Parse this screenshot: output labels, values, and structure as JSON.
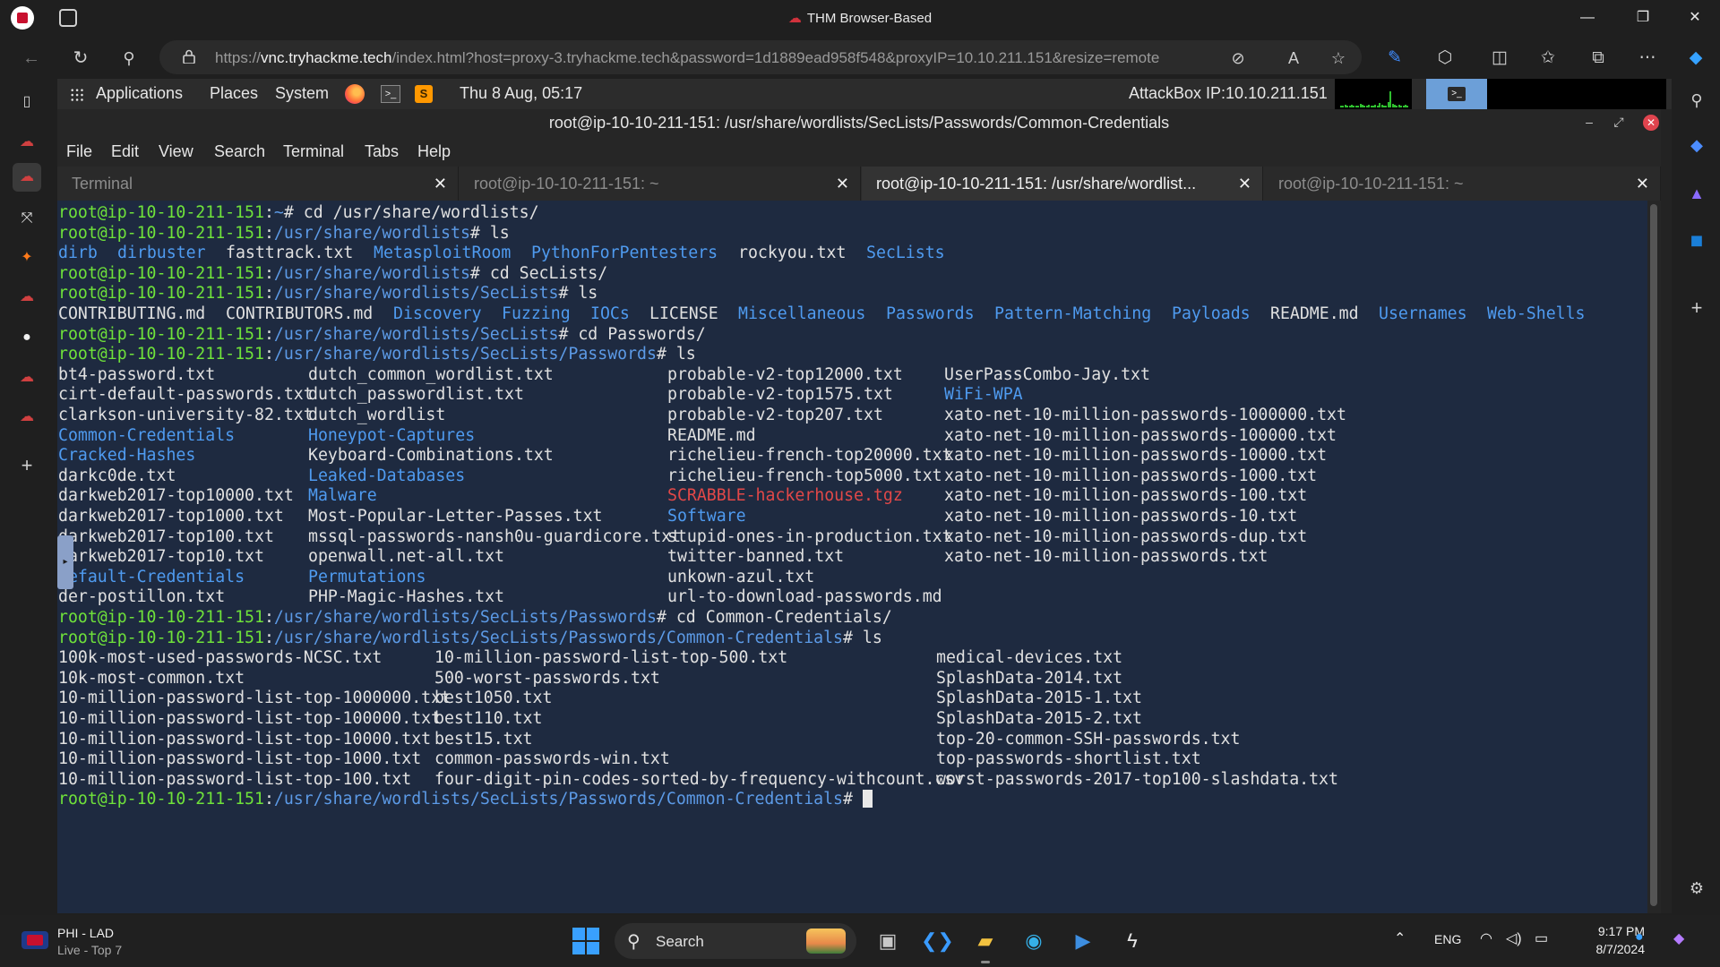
{
  "browser": {
    "window_title": "THM Browser-Based",
    "url_prefix": "https://",
    "url_host": "vnc.tryhackme.tech",
    "url_rest": "/index.html?host=proxy-3.tryhackme.tech&password=1d1889ead958f548&proxyIP=10.10.211.151&resize=remote",
    "icons": [
      "back-icon",
      "refresh-icon",
      "search-icon",
      "lock-icon",
      "no-tracking-icon",
      "read-aloud-icon",
      "favorite-star-icon",
      "copilot-pen-icon",
      "extensions-icon",
      "split-screen-icon",
      "favorites-icon",
      "collections-icon",
      "more-icon",
      "copilot-icon"
    ]
  },
  "vnc_panel": {
    "menus": [
      "Applications",
      "Places",
      "System"
    ],
    "datetime": "Thu 8 Aug, 05:17",
    "attackbox_ip": "AttackBox IP:10.10.211.151",
    "graph_color": "#2fbf2f"
  },
  "terminal_window": {
    "title": "root@ip-10-10-211-151: /usr/share/wordlists/SecLists/Passwords/Common-Credentials",
    "menu": [
      "File",
      "Edit",
      "View",
      "Search",
      "Terminal",
      "Tabs",
      "Help"
    ],
    "tabs": [
      {
        "label": "Terminal",
        "active": false
      },
      {
        "label": "root@ip-10-10-211-151: ~",
        "active": false
      },
      {
        "label": "root@ip-10-10-211-151: /usr/share/wordlist...",
        "active": true
      },
      {
        "label": "root@ip-10-10-211-151: ~",
        "active": false
      }
    ],
    "close_glyph": "✕"
  },
  "terminal_output": {
    "prompt_user": "root@ip-10-10-211-151",
    "lines": [
      {
        "type": "cmd",
        "path": "~",
        "cmd": "cd /usr/share/wordlists/"
      },
      {
        "type": "cmd",
        "path": "/usr/share/wordlists",
        "cmd": "ls"
      },
      {
        "type": "ls",
        "cols": [
          0,
          95,
          209,
          386,
          584,
          813
        ],
        "items": [
          {
            "t": "dirb",
            "k": "dir"
          },
          {
            "t": "dirbuster",
            "k": "dir"
          },
          {
            "t": "fasttrack.txt",
            "k": "file"
          },
          {
            "t": "MetasploitRoom",
            "k": "dir"
          },
          {
            "t": "PythonForPentesters",
            "k": "dir"
          },
          {
            "t": "rockyou.txt",
            "k": "file"
          },
          {
            "t": "SecLists",
            "k": "dir"
          }
        ]
      },
      {
        "type": "cmd",
        "path": "/usr/share/wordlists",
        "cmd": "cd SecLists/"
      },
      {
        "type": "cmd",
        "path": "/usr/share/wordlists/SecLists",
        "cmd": "ls"
      },
      {
        "type": "ls",
        "items": [
          {
            "t": "CONTRIBUTING.md",
            "k": "file"
          },
          {
            "t": "CONTRIBUTORS.md",
            "k": "file"
          },
          {
            "t": "Discovery",
            "k": "dir"
          },
          {
            "t": "Fuzzing",
            "k": "dir"
          },
          {
            "t": "IOCs",
            "k": "dir"
          },
          {
            "t": "LICENSE",
            "k": "file"
          },
          {
            "t": "Miscellaneous",
            "k": "dir"
          },
          {
            "t": "Passwords",
            "k": "dir"
          },
          {
            "t": "Pattern-Matching",
            "k": "dir"
          },
          {
            "t": "Payloads",
            "k": "dir"
          },
          {
            "t": "README.md",
            "k": "file"
          },
          {
            "t": "Usernames",
            "k": "dir"
          },
          {
            "t": "Web-Shells",
            "k": "dir"
          }
        ]
      },
      {
        "type": "cmd",
        "path": "/usr/share/wordlists/SecLists",
        "cmd": "cd Passwords/"
      },
      {
        "type": "cmd",
        "path": "/usr/share/wordlists/SecLists/Passwords",
        "cmd": "ls"
      }
    ],
    "passwords_ls": [
      [
        {
          "t": "bt4-password.txt",
          "k": "file"
        },
        {
          "t": "dutch_common_wordlist.txt",
          "k": "file"
        },
        {
          "t": "probable-v2-top12000.txt",
          "k": "file"
        },
        {
          "t": "UserPassCombo-Jay.txt",
          "k": "file"
        }
      ],
      [
        {
          "t": "cirt-default-passwords.txt",
          "k": "file"
        },
        {
          "t": "dutch_passwordlist.txt",
          "k": "file"
        },
        {
          "t": "probable-v2-top1575.txt",
          "k": "file"
        },
        {
          "t": "WiFi-WPA",
          "k": "dir"
        }
      ],
      [
        {
          "t": "clarkson-university-82.txt",
          "k": "file"
        },
        {
          "t": "dutch_wordlist",
          "k": "file"
        },
        {
          "t": "probable-v2-top207.txt",
          "k": "file"
        },
        {
          "t": "xato-net-10-million-passwords-1000000.txt",
          "k": "file"
        }
      ],
      [
        {
          "t": "Common-Credentials",
          "k": "dir"
        },
        {
          "t": "Honeypot-Captures",
          "k": "dir"
        },
        {
          "t": "README.md",
          "k": "file"
        },
        {
          "t": "xato-net-10-million-passwords-100000.txt",
          "k": "file"
        }
      ],
      [
        {
          "t": "Cracked-Hashes",
          "k": "dir"
        },
        {
          "t": "Keyboard-Combinations.txt",
          "k": "file"
        },
        {
          "t": "richelieu-french-top20000.txt",
          "k": "file"
        },
        {
          "t": "xato-net-10-million-passwords-10000.txt",
          "k": "file"
        }
      ],
      [
        {
          "t": "darkc0de.txt",
          "k": "file"
        },
        {
          "t": "Leaked-Databases",
          "k": "dir"
        },
        {
          "t": "richelieu-french-top5000.txt",
          "k": "file"
        },
        {
          "t": "xato-net-10-million-passwords-1000.txt",
          "k": "file"
        }
      ],
      [
        {
          "t": "darkweb2017-top10000.txt",
          "k": "file"
        },
        {
          "t": "Malware",
          "k": "dir"
        },
        {
          "t": "SCRABBLE-hackerhouse.tgz",
          "k": "archive"
        },
        {
          "t": "xato-net-10-million-passwords-100.txt",
          "k": "file"
        }
      ],
      [
        {
          "t": "darkweb2017-top1000.txt",
          "k": "file"
        },
        {
          "t": "Most-Popular-Letter-Passes.txt",
          "k": "file"
        },
        {
          "t": "Software",
          "k": "dir"
        },
        {
          "t": "xato-net-10-million-passwords-10.txt",
          "k": "file"
        }
      ],
      [
        {
          "t": "darkweb2017-top100.txt",
          "k": "file"
        },
        {
          "t": "mssql-passwords-nansh0u-guardicore.txt",
          "k": "file"
        },
        {
          "t": "stupid-ones-in-production.txt",
          "k": "file"
        },
        {
          "t": "xato-net-10-million-passwords-dup.txt",
          "k": "file"
        }
      ],
      [
        {
          "t": "darkweb2017-top10.txt",
          "k": "file"
        },
        {
          "t": "openwall.net-all.txt",
          "k": "file"
        },
        {
          "t": "twitter-banned.txt",
          "k": "file"
        },
        {
          "t": "xato-net-10-million-passwords.txt",
          "k": "file"
        }
      ],
      [
        {
          "t": "Default-Credentials",
          "k": "dir"
        },
        {
          "t": "Permutations",
          "k": "dir"
        },
        {
          "t": "unkown-azul.txt",
          "k": "file"
        },
        {
          "t": "",
          "k": "file"
        }
      ],
      [
        {
          "t": "der-postillon.txt",
          "k": "file"
        },
        {
          "t": "PHP-Magic-Hashes.txt",
          "k": "file"
        },
        {
          "t": "url-to-download-passwords.md",
          "k": "file"
        },
        {
          "t": "",
          "k": "file"
        }
      ]
    ],
    "cd_common": {
      "path": "/usr/share/wordlists/SecLists/Passwords",
      "cmd": "cd Common-Credentials/"
    },
    "ls_common": {
      "path": "/usr/share/wordlists/SecLists/Passwords/Common-Credentials",
      "cmd": "ls"
    },
    "common_ls": [
      [
        "100k-most-used-passwords-NCSC.txt",
        "10-million-password-list-top-500.txt",
        "medical-devices.txt"
      ],
      [
        "10k-most-common.txt",
        "500-worst-passwords.txt",
        "SplashData-2014.txt"
      ],
      [
        "10-million-password-list-top-1000000.txt",
        "best1050.txt",
        "SplashData-2015-1.txt"
      ],
      [
        "10-million-password-list-top-100000.txt",
        "best110.txt",
        "SplashData-2015-2.txt"
      ],
      [
        "10-million-password-list-top-10000.txt",
        "best15.txt",
        "top-20-common-SSH-passwords.txt"
      ],
      [
        "10-million-password-list-top-1000.txt",
        "common-passwords-win.txt",
        "top-passwords-shortlist.txt"
      ],
      [
        "10-million-password-list-top-100.txt",
        "four-digit-pin-codes-sorted-by-frequency-withcount.csv",
        "worst-passwords-2017-top100-slashdata.txt"
      ]
    ],
    "final_prompt_path": "/usr/share/wordlists/SecLists/Passwords/Common-Credentials"
  },
  "taskbar": {
    "widget_title": "PHI - LAD",
    "widget_subtitle": "Live - Top 7",
    "search_label": "Search",
    "lang": "ENG",
    "time": "9:17 PM",
    "date": "8/7/2024",
    "accent": "#3aa0ff"
  }
}
